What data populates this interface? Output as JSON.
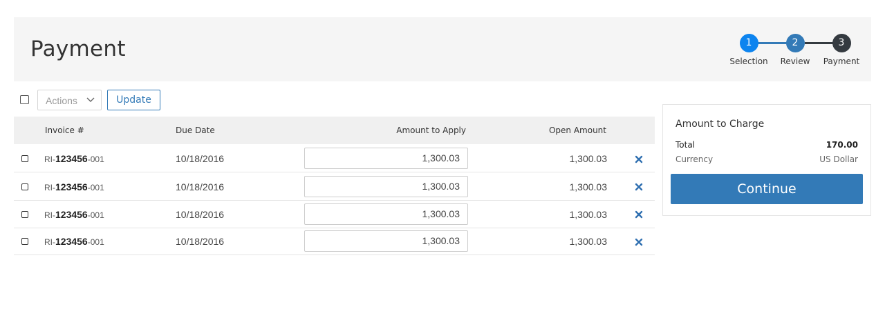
{
  "header": {
    "title": "Payment"
  },
  "stepper": {
    "steps": [
      {
        "number": "1",
        "label": "Selection",
        "color": "#0d84ef"
      },
      {
        "number": "2",
        "label": "Review",
        "color": "#337ab7"
      },
      {
        "number": "3",
        "label": "Payment",
        "color": "#343a40"
      }
    ]
  },
  "toolbar": {
    "actions_label": "Actions",
    "update_label": "Update"
  },
  "table": {
    "columns": {
      "invoice": "Invoice #",
      "due_date": "Due Date",
      "amount_to_apply": "Amount to Apply",
      "open_amount": "Open Amount"
    },
    "rows": [
      {
        "inv_prefix": "RI-",
        "inv_main": "123456",
        "inv_suffix": "-001",
        "due": "10/18/2016",
        "apply": "1,300.03",
        "open": "1,300.03"
      },
      {
        "inv_prefix": "RI-",
        "inv_main": "123456",
        "inv_suffix": "-001",
        "due": "10/18/2016",
        "apply": "1,300.03",
        "open": "1,300.03"
      },
      {
        "inv_prefix": "RI-",
        "inv_main": "123456",
        "inv_suffix": "-001",
        "due": "10/18/2016",
        "apply": "1,300.03",
        "open": "1,300.03"
      },
      {
        "inv_prefix": "RI-",
        "inv_main": "123456",
        "inv_suffix": "-001",
        "due": "10/18/2016",
        "apply": "1,300.03",
        "open": "1,300.03"
      }
    ]
  },
  "charge": {
    "title": "Amount to Charge",
    "total_label": "Total",
    "total_value": "170.00",
    "currency_label": "Currency",
    "currency_value": "US Dollar",
    "continue_label": "Continue"
  },
  "colors": {
    "accent": "#337ab7",
    "remove_icon": "#2f6fb0"
  },
  "icons": {
    "remove": "close-icon",
    "actions": "chevron-down-icon"
  }
}
